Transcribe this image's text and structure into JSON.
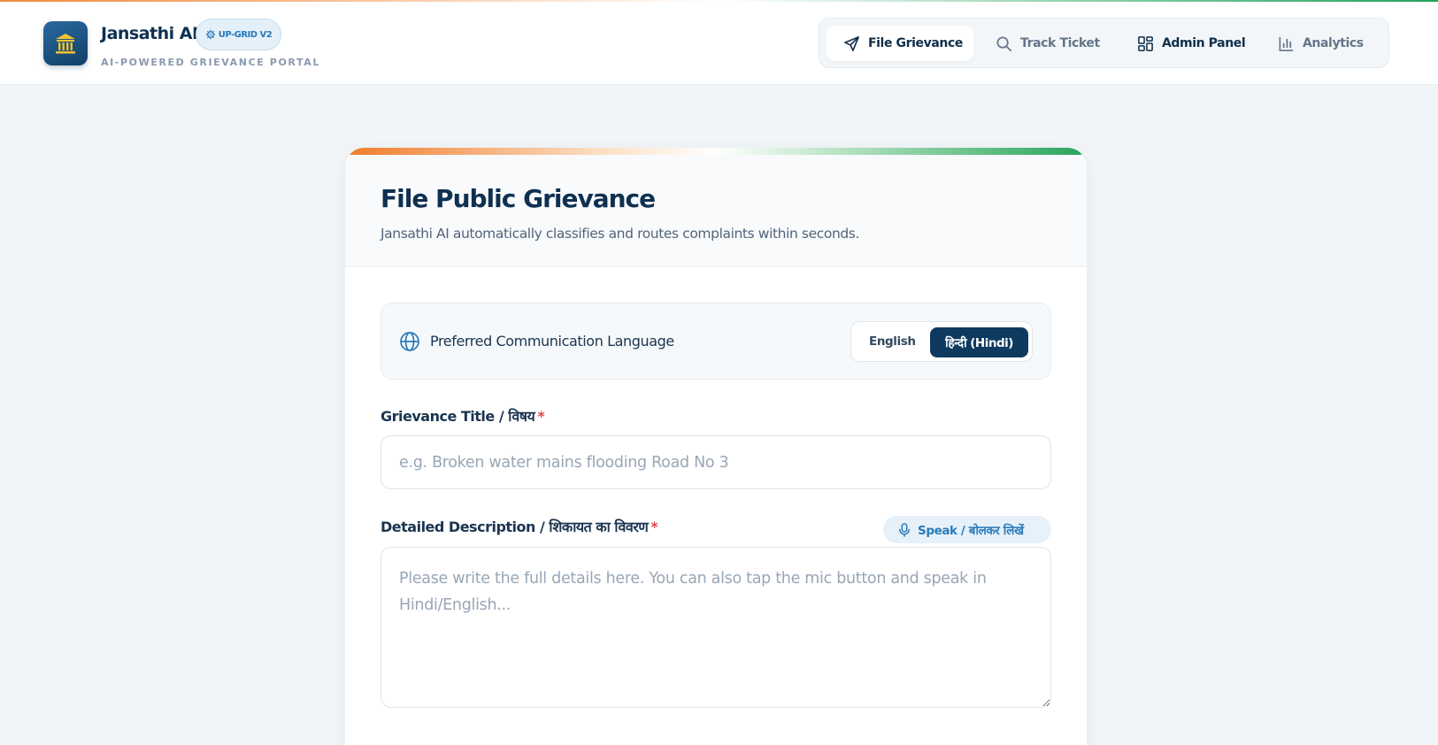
{
  "header": {
    "brand_name": "Jansathi AI",
    "badge": "UP-GRID V2",
    "tagline": "AI-POWERED GRIEVANCE PORTAL",
    "nav": [
      {
        "label": "File Grievance",
        "icon": "send-icon",
        "active": true
      },
      {
        "label": "Track Ticket",
        "icon": "search-icon",
        "active": false
      },
      {
        "label": "Admin Panel",
        "icon": "dashboard-grid-icon",
        "active": false
      },
      {
        "label": "Analytics",
        "icon": "bar-chart-icon",
        "active": false
      }
    ]
  },
  "form": {
    "title": "File Public Grievance",
    "subtitle": "Jansathi AI automatically classifies and routes complaints within seconds.",
    "language": {
      "label": "Preferred Communication Language",
      "options": [
        "English",
        "हिन्दी (Hindi)"
      ],
      "selected": "हिन्दी (Hindi)"
    },
    "grievance_title": {
      "label": "Grievance Title / विषय",
      "required_mark": "*",
      "value": "",
      "placeholder": "e.g. Broken water mains flooding Road No 3"
    },
    "description": {
      "label": "Detailed Description / शिकायत का विवरण",
      "required_mark": "*",
      "value": "",
      "placeholder": "Please write the full details here. You can also tap the mic button and speak in Hindi/English...",
      "speak_label": "Speak / बोलकर लिखें"
    }
  },
  "colors": {
    "primary": "#0f3a60",
    "accent": "#2a7ab8",
    "saffron": "#f07c2a",
    "green": "#27a458",
    "required": "#e04848"
  }
}
